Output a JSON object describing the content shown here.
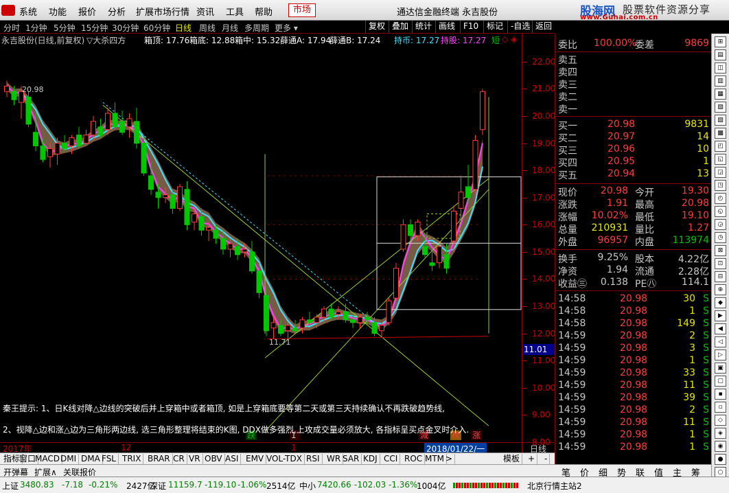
{
  "menubar": {
    "items": [
      "系统",
      "功能",
      "报价",
      "分析",
      "扩展市场行情",
      "资讯",
      "工具",
      "帮助"
    ],
    "active_tab": "市场",
    "app_title": "通达信金融终端",
    "stock_name": "永吉股份",
    "brand_main": "股海网",
    "brand_sub": "股票软件资源分享",
    "brand_url": "www.Guhai.com.cn"
  },
  "periods": {
    "items": [
      "分时",
      "1分钟",
      "5分钟",
      "15分钟",
      "30分钟",
      "60分钟",
      "日线",
      "周线",
      "月线",
      "多周期",
      "更多"
    ],
    "selected": "日线",
    "tools": [
      "复权",
      "叠加",
      "统计",
      "画线",
      "F10",
      "标记",
      "-自选",
      "返回"
    ]
  },
  "chart_header": {
    "title": "永吉股份(日线,前复权)",
    "indicator": "▽大杀四方",
    "box_top": "箱顶: 17.76",
    "box_bottom": "箱底: 12.88",
    "box_mid": "箱中: 15.32",
    "xue_a": "薛通A: 17.94",
    "xue_b": "薛通B: 17.24",
    "hold_coin": "持币: 17.27",
    "hold_stock": "持股: 17.27",
    "short": "短"
  },
  "chart_data": {
    "type": "candlestick",
    "ylim": [
      8.0,
      22.6
    ],
    "yticks": [
      "22.00",
      "21.00",
      "20.00",
      "19.00",
      "18.00",
      "17.00",
      "16.00",
      "15.00",
      "14.00",
      "13.00",
      "12.00",
      "11.00",
      "10.00",
      "9.00",
      "8.00"
    ],
    "candles": [
      [
        20.9,
        21.3,
        20.7,
        21.1
      ],
      [
        20.9,
        21.1,
        20.4,
        20.6
      ],
      [
        20.5,
        21.1,
        19.9,
        20.9
      ],
      [
        20.7,
        20.9,
        19.6,
        19.7
      ],
      [
        19.4,
        20.1,
        18.7,
        18.9
      ],
      [
        18.9,
        19.2,
        18.3,
        18.4
      ],
      [
        18.5,
        19.0,
        18.1,
        18.8
      ],
      [
        18.6,
        19.2,
        18.2,
        19.0
      ],
      [
        19.0,
        19.3,
        18.7,
        18.8
      ],
      [
        18.9,
        19.3,
        18.6,
        19.2
      ],
      [
        19.3,
        19.6,
        18.8,
        18.9
      ],
      [
        19.0,
        19.5,
        18.9,
        19.3
      ],
      [
        19.3,
        20.0,
        19.1,
        19.8
      ],
      [
        19.6,
        19.9,
        19.2,
        19.3
      ],
      [
        19.5,
        20.3,
        19.3,
        20.1
      ],
      [
        20.1,
        20.5,
        19.5,
        19.6
      ],
      [
        19.8,
        20.2,
        19.3,
        19.4
      ],
      [
        19.6,
        20.1,
        19.2,
        19.9
      ],
      [
        19.8,
        20.3,
        18.8,
        19.0
      ],
      [
        19.0,
        19.3,
        17.8,
        17.9
      ],
      [
        17.8,
        18.3,
        17.1,
        17.3
      ],
      [
        17.2,
        17.5,
        16.6,
        17.0
      ],
      [
        17.0,
        17.4,
        16.8,
        17.1
      ],
      [
        17.1,
        17.3,
        16.4,
        16.6
      ],
      [
        16.6,
        17.5,
        16.5,
        17.4
      ],
      [
        17.3,
        17.6,
        15.8,
        16.0
      ],
      [
        16.1,
        16.6,
        15.8,
        16.4
      ],
      [
        16.3,
        16.6,
        15.6,
        15.8
      ],
      [
        15.8,
        16.1,
        15.4,
        15.9
      ],
      [
        15.8,
        16.0,
        15.3,
        15.5
      ],
      [
        15.5,
        15.8,
        14.9,
        15.1
      ],
      [
        15.1,
        15.5,
        14.8,
        15.3
      ],
      [
        15.2,
        15.5,
        14.7,
        14.9
      ],
      [
        15.0,
        15.3,
        14.8,
        15.1
      ],
      [
        15.0,
        15.4,
        14.2,
        14.3
      ],
      [
        14.3,
        14.6,
        13.3,
        13.5
      ],
      [
        13.4,
        13.7,
        11.9,
        12.1
      ],
      [
        12.2,
        12.6,
        11.8,
        12.4
      ],
      [
        12.3,
        12.5,
        11.9,
        12.0
      ],
      [
        12.1,
        12.4,
        11.8,
        12.3
      ],
      [
        12.2,
        12.5,
        12.0,
        12.1
      ],
      [
        12.2,
        12.6,
        12.0,
        12.5
      ],
      [
        12.5,
        12.8,
        12.3,
        12.4
      ],
      [
        12.4,
        12.7,
        12.2,
        12.6
      ],
      [
        12.6,
        13.0,
        12.4,
        12.9
      ],
      [
        12.9,
        13.1,
        12.5,
        12.6
      ],
      [
        12.7,
        13.0,
        12.5,
        12.8
      ],
      [
        12.8,
        13.1,
        12.4,
        12.5
      ],
      [
        12.5,
        12.8,
        12.2,
        12.4
      ],
      [
        12.4,
        12.7,
        12.2,
        12.6
      ],
      [
        12.6,
        12.8,
        12.3,
        12.5
      ],
      [
        12.4,
        12.6,
        11.9,
        12.0
      ],
      [
        12.1,
        12.4,
        11.9,
        12.3
      ],
      [
        12.4,
        13.3,
        12.3,
        13.2
      ],
      [
        13.3,
        14.6,
        13.2,
        14.4
      ],
      [
        15.1,
        16.2,
        15.0,
        16.0
      ],
      [
        16.0,
        16.2,
        15.4,
        15.6
      ],
      [
        15.6,
        16.2,
        15.4,
        16.1
      ],
      [
        15.2,
        15.7,
        14.8,
        14.9
      ],
      [
        14.6,
        15.0,
        14.3,
        14.5
      ],
      [
        14.6,
        15.3,
        14.4,
        15.2
      ],
      [
        14.9,
        15.3,
        14.2,
        14.4
      ],
      [
        15.4,
        16.7,
        15.0,
        16.5
      ],
      [
        16.6,
        17.8,
        16.1,
        17.2
      ],
      [
        17.4,
        18.2,
        16.8,
        17.0
      ],
      [
        17.3,
        19.3,
        17.1,
        19.1
      ],
      [
        19.5,
        21.0,
        19.3,
        20.9
      ]
    ],
    "labels": [
      "20.98",
      "11.71"
    ],
    "markers": [
      "跌",
      "1",
      "減",
      "榜",
      "涨"
    ]
  },
  "hint": {
    "line1": "秦王提示: 1、日K线对降△边线的突破后并上穿箱中或者箱顶, 如是上穿箱底要等第二天或第三天持续确认不再跌破趋势线,",
    "line2": "2、视降△边和涨△边为三角形两边线, 选三角形整理将结束的K图, DDX做多强烈,上攻成交量必须放大, 各指标呈买点金叉时介入."
  },
  "cursor_price": "11.01",
  "datebar": {
    "year": "2017年",
    "month": "12",
    "mark": "1",
    "selected": "2018/01/22/一",
    "right": "日线"
  },
  "indicators": [
    "指标",
    "窗口",
    "MACD",
    "DMI",
    "DMA",
    "FSL",
    "TRIX",
    "BRAR",
    "CR",
    "VR",
    "OBV",
    "ASI",
    "EMV",
    "VOL-TDX",
    "RSI",
    "WR",
    "SAR",
    "KDJ",
    "CCI",
    "ROC",
    "MTM",
    ">",
    "模板",
    "+",
    "-"
  ],
  "subbar": [
    "开弹幕",
    "扩展∧",
    "关联报价"
  ],
  "quote": {
    "weibi_label": "委比",
    "weibi": "100.00%",
    "weicha_label": "委差",
    "weicha": "9869",
    "sell": [
      {
        "label": "卖五"
      },
      {
        "label": "卖四"
      },
      {
        "label": "卖三"
      },
      {
        "label": "卖二"
      },
      {
        "label": "卖一"
      }
    ],
    "buy": [
      {
        "label": "买一",
        "price": "20.98",
        "vol": "9831"
      },
      {
        "label": "买二",
        "price": "20.97",
        "vol": "14"
      },
      {
        "label": "买三",
        "price": "20.96",
        "vol": "10"
      },
      {
        "label": "买四",
        "price": "20.95",
        "vol": "1"
      },
      {
        "label": "买五",
        "price": "20.94",
        "vol": "13"
      }
    ],
    "stats": [
      {
        "l1": "现价",
        "v1": "20.98",
        "l2": "今开",
        "v2": "19.30"
      },
      {
        "l1": "涨跌",
        "v1": "1.91",
        "l2": "最高",
        "v2": "20.98"
      },
      {
        "l1": "涨幅",
        "v1": "10.02%",
        "l2": "最低",
        "v2": "19.10"
      },
      {
        "l1": "总量",
        "v1": "210931",
        "l2": "量比",
        "v2": "1.27"
      },
      {
        "l1": "外盘",
        "v1": "96957",
        "l2": "内盘",
        "v2": "113974"
      }
    ],
    "stats2": [
      {
        "l1": "换手",
        "v1": "9.25%",
        "l2": "股本",
        "v2": "4.22亿"
      },
      {
        "l1": "净资",
        "v1": "1.94",
        "l2": "流通",
        "v2": "2.28亿"
      },
      {
        "l1": "收益㊂",
        "v1": "0.138",
        "l2": "PE㊇",
        "v2": "114.1"
      }
    ],
    "ticks": [
      {
        "t": "14:58",
        "p": "20.98",
        "v": "30",
        "s": "S"
      },
      {
        "t": "14:58",
        "p": "20.98",
        "v": "1",
        "s": "S"
      },
      {
        "t": "14:58",
        "p": "20.98",
        "v": "149",
        "s": "S"
      },
      {
        "t": "14:59",
        "p": "20.98",
        "v": "2",
        "s": "S"
      },
      {
        "t": "14:59",
        "p": "20.98",
        "v": "3",
        "s": "S"
      },
      {
        "t": "14:59",
        "p": "20.98",
        "v": "1",
        "s": "S"
      },
      {
        "t": "14:59",
        "p": "20.98",
        "v": "33",
        "s": "S"
      },
      {
        "t": "14:59",
        "p": "20.98",
        "v": "11",
        "s": "S"
      },
      {
        "t": "14:59",
        "p": "20.98",
        "v": "39",
        "s": "S"
      },
      {
        "t": "14:59",
        "p": "20.98",
        "v": "2",
        "s": "S"
      },
      {
        "t": "14:59",
        "p": "20.98",
        "v": "11",
        "s": "S"
      },
      {
        "t": "14:59",
        "p": "20.98",
        "v": "1",
        "s": "S"
      },
      {
        "t": "14:59",
        "p": "20.98",
        "v": "1",
        "s": "S"
      }
    ]
  },
  "rtabs": [
    "笔",
    "价",
    "细",
    "势",
    "联",
    "值",
    "主",
    "筹"
  ],
  "statusbar": {
    "sh_label": "上证",
    "sh_val": "3480.83",
    "sh_chg": "-7.18",
    "sh_pct": "-0.21%",
    "sh_amt": "2427亿",
    "sz_label": "深证",
    "sz_val": "11159.7",
    "sz_chg": "-119.10",
    "sz_pct": "-1.06%",
    "sz_amt": "2514亿",
    "zx_label": "中小",
    "zx_val": "7420.66",
    "zx_chg": "-102.03",
    "zx_pct": "-1.36%",
    "zx_amt": "1004亿",
    "server": "北京行情主站2"
  },
  "colors": {
    "up": "#ff3c3c",
    "down": "#00c800",
    "bg": "#000000",
    "ma_cyan": "#40e0ff",
    "ma_magenta": "#ff40ff",
    "ribbon": "#8a6a50"
  }
}
